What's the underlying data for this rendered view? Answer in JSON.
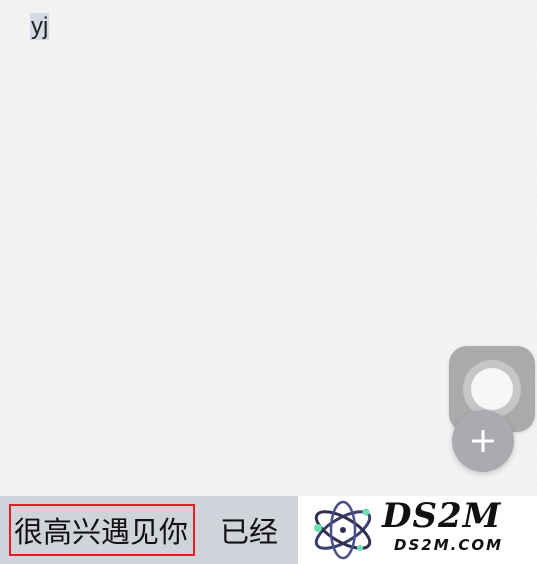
{
  "editor": {
    "composing_text": "yj"
  },
  "floating": {
    "assistive_ball_icon": "assistive-touch-icon",
    "add_button_icon": "plus-icon"
  },
  "keyboard": {
    "candidates": [
      {
        "text": "很高兴遇见你",
        "selected": true
      },
      {
        "text": "已经",
        "selected": false
      }
    ],
    "highlight_color": "#e02020"
  },
  "watermark": {
    "title": "DS2M",
    "subtitle": "DS2M.COM",
    "logo_icon": "atom-logo-icon"
  }
}
